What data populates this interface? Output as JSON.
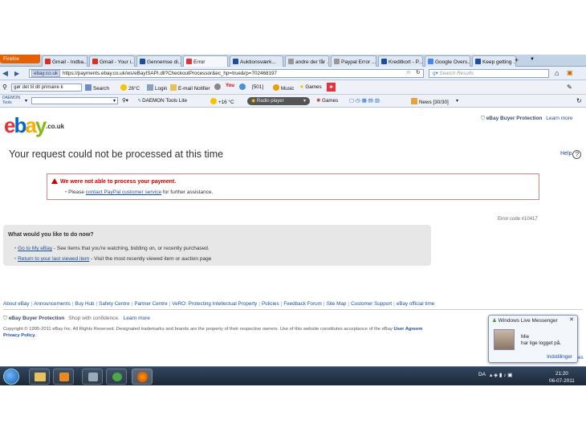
{
  "firefox_label": "Firefox",
  "tabs": [
    {
      "label": "Gmail - Indba...",
      "color": "#d93025"
    },
    {
      "label": "Gmail - Your i...",
      "color": "#d93025"
    },
    {
      "label": "Gennemse di...",
      "color": "#1d4e9e"
    },
    {
      "label": "Error",
      "color": "#e53238",
      "active": true
    },
    {
      "label": "Auktionsværk...",
      "color": "#1d4e9e"
    },
    {
      "label": "andre der får ...",
      "color": "#999999"
    },
    {
      "label": "Paypal Error ...",
      "color": "#999999"
    },
    {
      "label": "Kreditkort - P...",
      "color": "#1d4e9e"
    },
    {
      "label": "Google Overs...",
      "color": "#4285f4"
    },
    {
      "label": "Keep getting ...",
      "color": "#1d4e9e"
    }
  ],
  "nav": {
    "identity": "ebay.co.uk",
    "url": "https://payments.ebay.co.uk/ws/eBayISAPI.dll?CheckoutProcessor&ec_hp=true&rp=702468197",
    "search_placeholder": "Search Results"
  },
  "toolbar1": {
    "search_combo": "gør det til dit primære k",
    "search": "Search",
    "weather": "26°C",
    "login": "Login",
    "email": "E-mail Notifier",
    "count": "[501]",
    "music": "Music",
    "games": "Games"
  },
  "toolbar2": {
    "daemon_logo": "DAEMON Tools",
    "daemon_lite": "DAEMON Tools Lite",
    "temp": "+16 °C",
    "radio": "Radio player",
    "games": "Games",
    "news": "News [30/30]"
  },
  "page": {
    "logo_letters": [
      "e",
      "b",
      "a",
      "y"
    ],
    "logo_tld": ".co.uk",
    "buyer_protection": "eBay Buyer Protection",
    "learn_more": "Learn more",
    "title": "Your request could not be processed at this time",
    "help": "Help",
    "error_title": "We were not able to process your payment.",
    "error_pre": "Please ",
    "error_link": "contact PayPal customer service",
    "error_post": " for further assistance.",
    "error_code": "Error code #10417",
    "what_title": "What would you like to do now?",
    "options": [
      {
        "link": "Go to My eBay",
        "text": " - See items that you're watching, bidding on, or recently purchased."
      },
      {
        "link": "Return to your last viewed item",
        "text": " - Visit the most recently viewed item or auction page"
      }
    ],
    "footer_links": [
      "About eBay",
      "Announcements",
      "Buy Hub",
      "Safety Centre",
      "Partner Centre",
      "VeRO: Protecting Intellectual Property",
      "Policies",
      "Feedback Forum",
      "Site Map",
      "Customer Support",
      "eBay official time"
    ],
    "footer_bp": "eBay Buyer Protection",
    "footer_shop": "Shop with confidence.",
    "footer_learn": "Learn more",
    "copyright": "Copyright © 1995-2011 eBay Inc. All Rights Reserved. Designated trademarks and brands are the property of their respective owners. Use of this website constitutes acceptance of the eBay ",
    "user_agreement": "User Agreem",
    "privacy": "Privacy Policy."
  },
  "messenger": {
    "title": "Windows Live Messenger",
    "name": "Mie",
    "status": "har lige logget på.",
    "settings": "Indstillinger",
    "behind_text": "es"
  },
  "taskbar": {
    "lang": "DA",
    "time": "21:20",
    "date": "06-07-2011"
  }
}
